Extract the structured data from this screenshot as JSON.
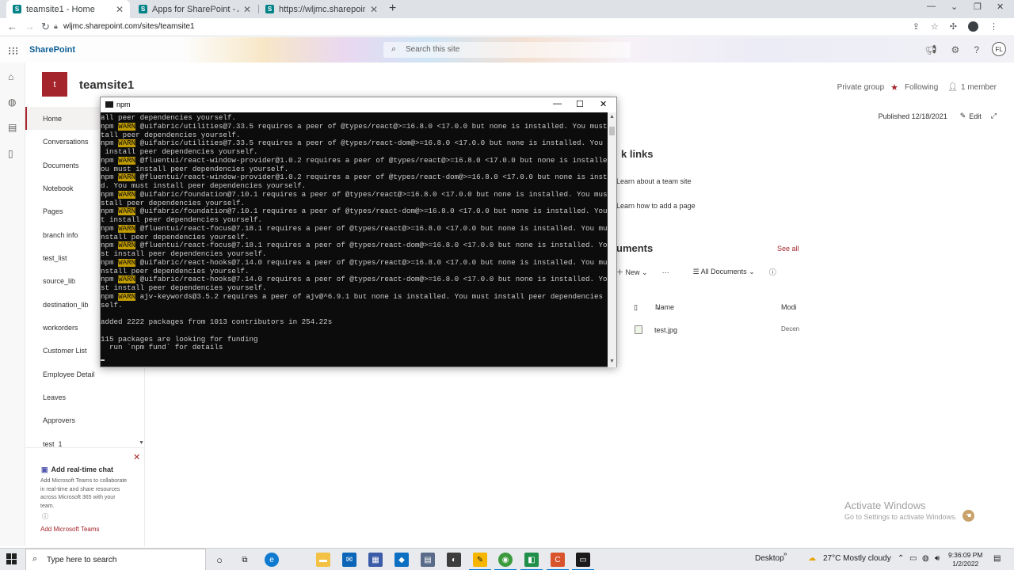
{
  "browser": {
    "tabs": [
      {
        "title": "teamsite1 - Home",
        "active": true
      },
      {
        "title": "Apps for SharePoint - All Apps",
        "active": false
      },
      {
        "title": "https://wljmc.sharepoint.com/sit",
        "active": false
      }
    ],
    "url": "wljmc.sharepoint.com/sites/teamsite1"
  },
  "suite": {
    "brand": "SharePoint",
    "search_placeholder": "Search this site",
    "user_initials": "FL"
  },
  "site": {
    "logo_letter": "t",
    "title": "teamsite1",
    "privacy": "Private group",
    "following": "Following",
    "members": "1 member"
  },
  "nav": {
    "items": [
      "Home",
      "Conversations",
      "Documents",
      "Notebook",
      "Pages",
      "branch info",
      "test_list",
      "source_lib",
      "destination_lib",
      "workorders",
      "Customer List",
      "Employee Detail",
      "Leaves",
      "Approvers",
      "test_1"
    ],
    "selected": 0
  },
  "chat": {
    "title": "Add real-time chat",
    "body": "Add Microsoft Teams to collaborate in real-time and share resources across Microsoft 365 with your team.",
    "link": "Add Microsoft Teams"
  },
  "page": {
    "published": "Published 12/18/2021",
    "edit": "Edit",
    "quick_links_title": "k links",
    "quick_links": [
      "Learn about a team site",
      "Learn how to add a page"
    ],
    "documents_title": "uments",
    "see_all": "See all",
    "new_label": "New",
    "more_label": "···",
    "view_label": "All Documents",
    "col_name": "Name",
    "col_modified": "Modi",
    "file_name": "test.jpg",
    "file_modified": "Decen"
  },
  "terminal": {
    "title": "npm",
    "lines": [
      [
        "",
        "all peer dependencies yourself."
      ],
      [
        "npm ",
        "WARN",
        " @uifabric/utilities@7.33.5 requires a peer of @types/react@>=16.8.0 <17.0.0 but none is installed. You must ins"
      ],
      [
        "",
        "tall peer dependencies yourself."
      ],
      [
        "npm ",
        "WARN",
        " @uifabric/utilities@7.33.5 requires a peer of @types/react-dom@>=16.8.0 <17.0.0 but none is installed. You must"
      ],
      [
        "",
        " install peer dependencies yourself."
      ],
      [
        "npm ",
        "WARN",
        " @fluentui/react-window-provider@1.0.2 requires a peer of @types/react@>=16.8.0 <17.0.0 but none is installed. Y"
      ],
      [
        "",
        "ou must install peer dependencies yourself."
      ],
      [
        "npm ",
        "WARN",
        " @fluentui/react-window-provider@1.0.2 requires a peer of @types/react-dom@>=16.8.0 <17.0.0 but none is installe"
      ],
      [
        "",
        "d. You must install peer dependencies yourself."
      ],
      [
        "npm ",
        "WARN",
        " @uifabric/foundation@7.10.1 requires a peer of @types/react@>=16.8.0 <17.0.0 but none is installed. You must in"
      ],
      [
        "",
        "stall peer dependencies yourself."
      ],
      [
        "npm ",
        "WARN",
        " @uifabric/foundation@7.10.1 requires a peer of @types/react-dom@>=16.8.0 <17.0.0 but none is installed. You mus"
      ],
      [
        "",
        "t install peer dependencies yourself."
      ],
      [
        "npm ",
        "WARN",
        " @fluentui/react-focus@7.18.1 requires a peer of @types/react@>=16.8.0 <17.0.0 but none is installed. You must i"
      ],
      [
        "",
        "nstall peer dependencies yourself."
      ],
      [
        "npm ",
        "WARN",
        " @fluentui/react-focus@7.18.1 requires a peer of @types/react-dom@>=16.8.0 <17.0.0 but none is installed. You mu"
      ],
      [
        "",
        "st install peer dependencies yourself."
      ],
      [
        "npm ",
        "WARN",
        " @uifabric/react-hooks@7.14.0 requires a peer of @types/react@>=16.8.0 <17.0.0 but none is installed. You must i"
      ],
      [
        "",
        "nstall peer dependencies yourself."
      ],
      [
        "npm ",
        "WARN",
        " @uifabric/react-hooks@7.14.0 requires a peer of @types/react-dom@>=16.8.0 <17.0.0 but none is installed. You mu"
      ],
      [
        "",
        "st install peer dependencies yourself."
      ],
      [
        "npm ",
        "WARN",
        " ajv-keywords@3.5.2 requires a peer of ajv@^6.9.1 but none is installed. You must install peer dependencies your"
      ],
      [
        "",
        "self."
      ],
      [
        "",
        ""
      ],
      [
        "",
        "added 2222 packages from 1013 contributors in 254.22s"
      ],
      [
        "",
        ""
      ],
      [
        "",
        "115 packages are looking for funding"
      ],
      [
        "",
        "  run `npm fund` for details"
      ],
      [
        "",
        ""
      ]
    ]
  },
  "watermark": {
    "line1": "Activate Windows",
    "line2": "Go to Settings to activate Windows."
  },
  "taskbar": {
    "search_placeholder": "Type here to search",
    "desktop": "Desktop",
    "weather": "27°C  Mostly cloudy",
    "time": "9:36:09 PM",
    "date": "1/2/2022"
  }
}
